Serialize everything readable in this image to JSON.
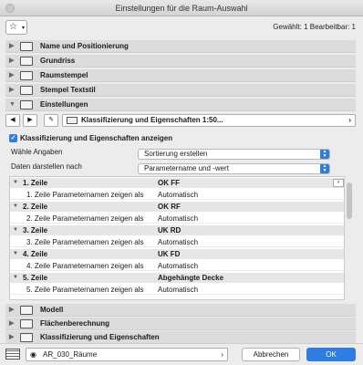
{
  "window": {
    "title": "Einstellungen für die Raum-Auswahl"
  },
  "header": {
    "selection_info": "Gewählt: 1 Bearbeitbar: 1"
  },
  "panels_top": [
    {
      "label": "Name und Positionierung",
      "icon": "name-position-icon"
    },
    {
      "label": "Grundriss",
      "icon": "floorplan-icon"
    },
    {
      "label": "Raumstempel",
      "icon": "zone-stamp-icon"
    },
    {
      "label": "Stempel Textstil",
      "icon": "text-style-icon"
    },
    {
      "label": "Einstellungen",
      "icon": "settings-icon"
    }
  ],
  "nav": {
    "field_label": "Klassifizierung und Eigenschaften 1:50..."
  },
  "options": {
    "show_checkbox_label": "Klassifizierung und Eigenschaften anzeigen",
    "choose_label": "Wähle Angaben",
    "choose_value": "Sortierung erstellen",
    "display_label": "Daten darstellen nach",
    "display_value": "Parametername und -wert"
  },
  "table": {
    "rows": [
      {
        "kind": "hdr",
        "c1": "1. Zeile",
        "c2": "OK FF"
      },
      {
        "kind": "sub",
        "c1": "1. Zeile Parameternamen zeigen als",
        "c2": "Automatisch"
      },
      {
        "kind": "hdr",
        "c1": "2. Zeile",
        "c2": "OK RF"
      },
      {
        "kind": "sub",
        "c1": "2. Zeile Parameternamen zeigen als",
        "c2": "Automatisch"
      },
      {
        "kind": "hdr",
        "c1": "3. Zeile",
        "c2": "UK RD"
      },
      {
        "kind": "sub",
        "c1": "3. Zeile Parameternamen zeigen als",
        "c2": "Automatisch"
      },
      {
        "kind": "hdr",
        "c1": "4. Zeile",
        "c2": "UK FD"
      },
      {
        "kind": "sub",
        "c1": "4. Zeile Parameternamen zeigen als",
        "c2": "Automatisch"
      },
      {
        "kind": "hdr",
        "c1": "5. Zeile",
        "c2": "Abgehängte Decke"
      },
      {
        "kind": "sub",
        "c1": "5. Zeile Parameternamen zeigen als",
        "c2": "Automatisch"
      }
    ]
  },
  "panels_bottom": [
    {
      "label": "Modell",
      "icon": "model-icon"
    },
    {
      "label": "Flächenberechnung",
      "icon": "area-calc-icon"
    },
    {
      "label": "Klassifizierung und Eigenschaften",
      "icon": "classification-icon"
    }
  ],
  "footer": {
    "layer_value": "AR_030_Räume",
    "cancel_label": "Abbrechen",
    "ok_label": "OK"
  },
  "colors": {
    "accent": "#2f7de1"
  }
}
